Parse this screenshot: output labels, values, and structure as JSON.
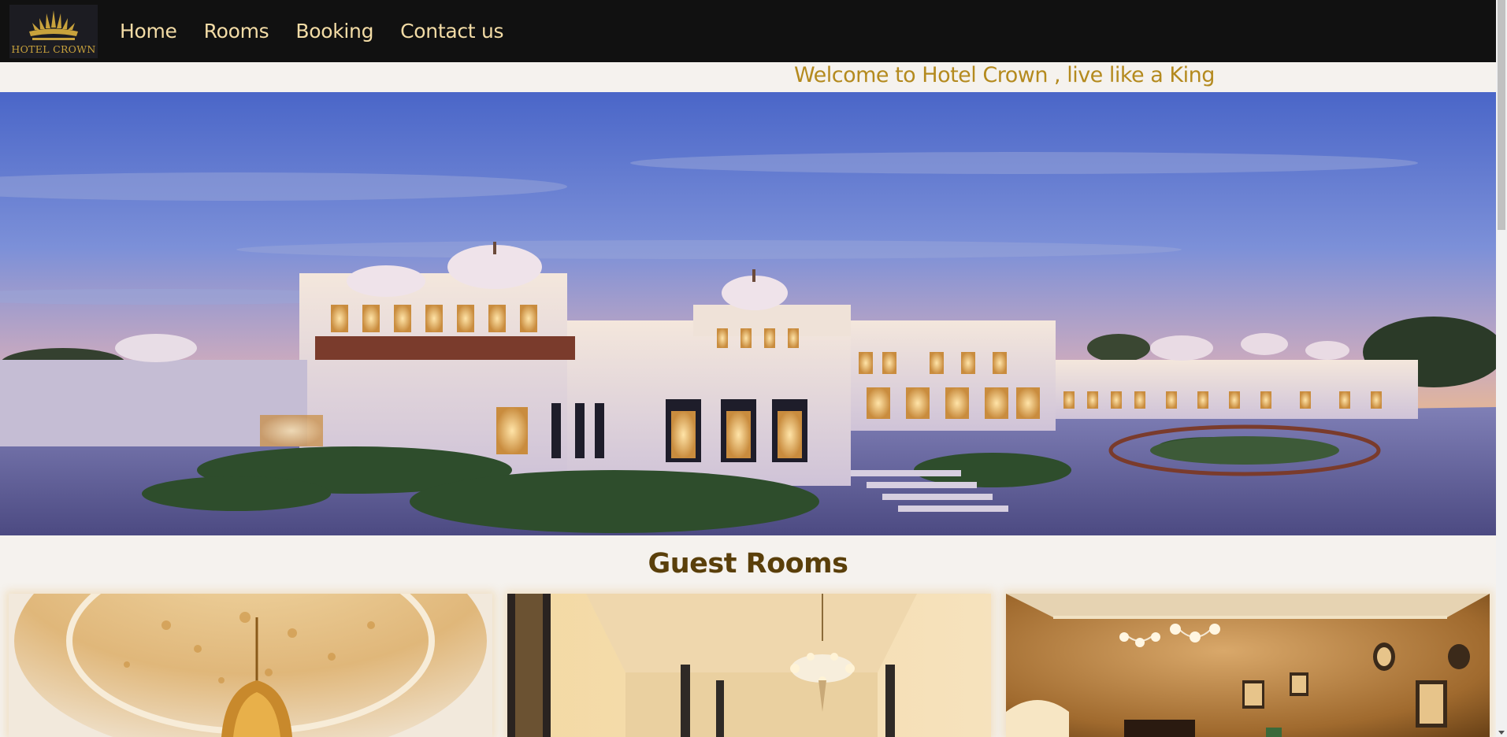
{
  "navbar": {
    "logo_text": "HOTEL CROWN",
    "links": [
      {
        "label": "Home"
      },
      {
        "label": "Rooms"
      },
      {
        "label": "Booking"
      },
      {
        "label": "Contact us"
      }
    ]
  },
  "welcome": {
    "text": "Welcome to Hotel Crown , live like a King"
  },
  "guest_rooms": {
    "title": "Guest Rooms"
  },
  "colors": {
    "navbar_bg": "#111111",
    "nav_link": "#f3dca6",
    "logo_gold": "#c8a23c",
    "welcome_text": "#b48a1e",
    "section_title": "#5a3f0a",
    "page_bg": "#f5f2ee"
  },
  "icons": {
    "logo": "crown-icon",
    "scroll_down": "chevron-down-icon"
  }
}
